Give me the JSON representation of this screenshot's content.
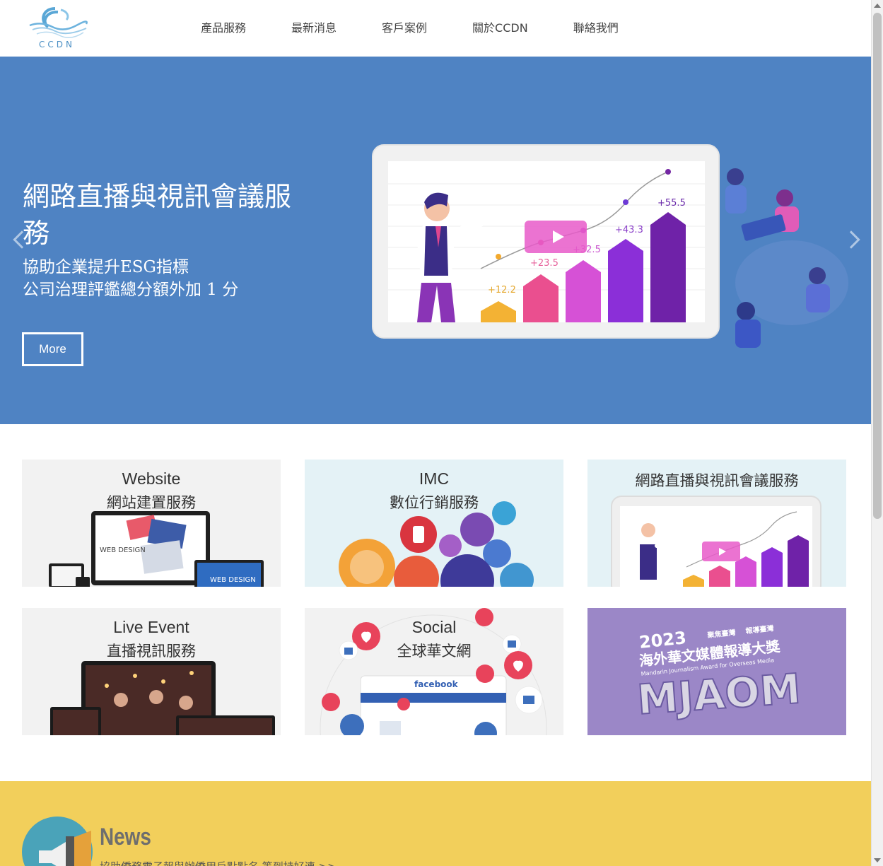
{
  "brand": {
    "logo_text": "CCDN",
    "accent": "#4f83c3",
    "news_bg": "#f2cf5b",
    "news_circle": "#4aa3b9"
  },
  "nav": {
    "items": [
      {
        "label": "產品服務"
      },
      {
        "label": "最新消息"
      },
      {
        "label": "客戶案例"
      },
      {
        "label": "關於CCDN"
      },
      {
        "label": "聯絡我們"
      }
    ]
  },
  "hero": {
    "title": "網路直播與視訊會議服務",
    "subtitle_line1": "協助企業提升ESG指標",
    "subtitle_line2": "公司治理評鑑總分額外加 1 分",
    "button_label": "More",
    "chart_labels": [
      "+12.2",
      "+23.5",
      "+32.5",
      "+43.3",
      "+55.5"
    ]
  },
  "cards": [
    {
      "title": "Website",
      "subtitle": "網站建置服務",
      "screen_text": "WEB DESIGN",
      "bg": "#f2f2f2"
    },
    {
      "title": "IMC",
      "subtitle": "數位行銷服務",
      "bg": "#e4f2f6"
    },
    {
      "title": "網路直播與視訊會議服務",
      "subtitle": "",
      "bg": "#e4f2f6"
    },
    {
      "title": "Live Event",
      "subtitle": "直播視訊服務",
      "bg": "#f2f2f2"
    },
    {
      "title": "Social",
      "subtitle": "全球華文網",
      "fb_text": "facebook",
      "bg": "#f2f2f2"
    },
    {
      "title": "",
      "subtitle": "",
      "year": "2023",
      "award_cn": "海外華文媒體報導大獎",
      "award_en": "Mandarin Journalism Award for Overseas Media",
      "badge1": "聚焦臺灣",
      "badge2": "報導臺灣",
      "logo": "MJAOM",
      "bg": "#9b87c7"
    }
  ],
  "news": {
    "title": "News",
    "text": "協助僑務電子報與辦僑用戶點點名 等到持好連 >>"
  }
}
